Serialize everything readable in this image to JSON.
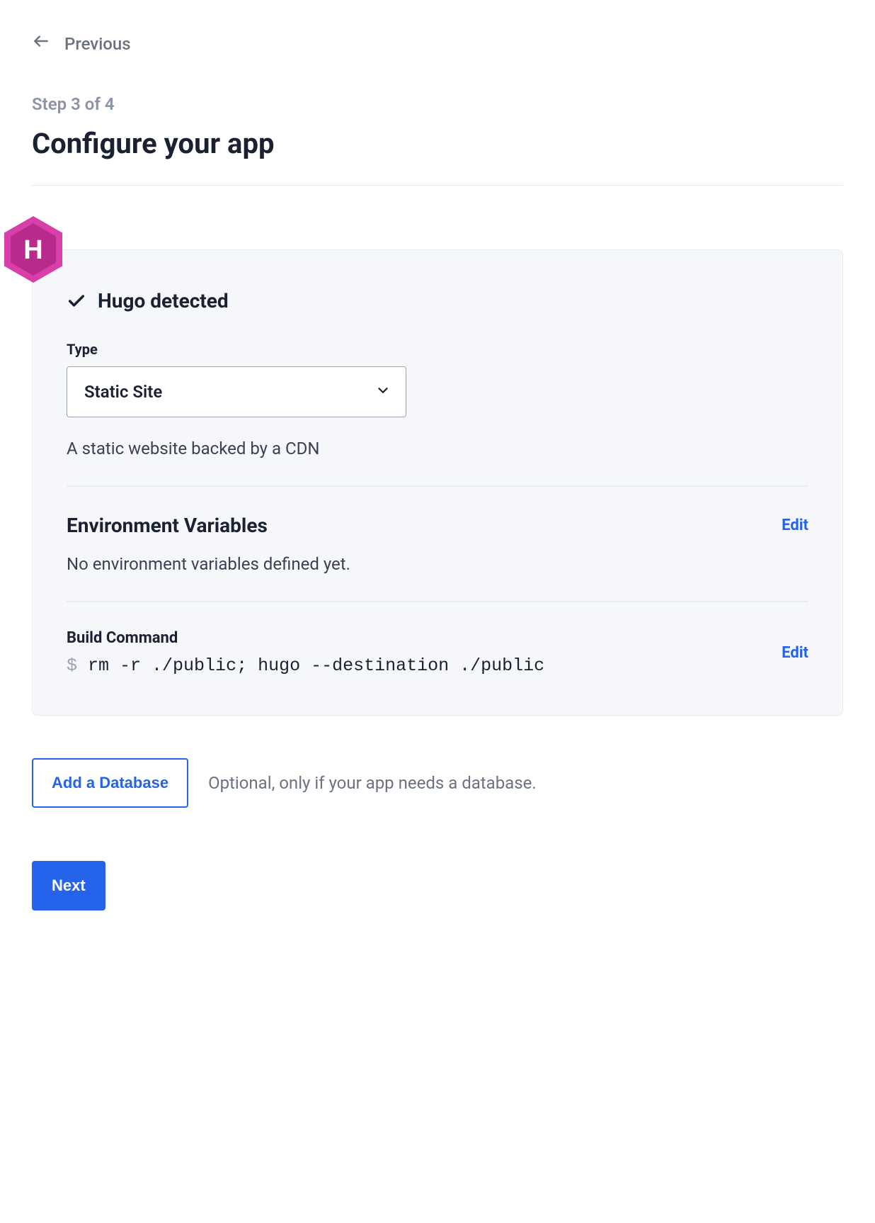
{
  "nav": {
    "previous_label": "Previous"
  },
  "header": {
    "step_label": "Step 3 of 4",
    "title": "Configure your app"
  },
  "card": {
    "badge_letter": "H",
    "detected_label": "Hugo detected",
    "type_label": "Type",
    "type_value": "Static Site",
    "type_description": "A static website backed by a CDN",
    "env_section_title": "Environment Variables",
    "env_edit_label": "Edit",
    "env_empty_text": "No environment variables defined yet.",
    "build_section_label": "Build Command",
    "build_edit_label": "Edit",
    "build_prompt": "$",
    "build_command": "rm -r ./public; hugo --destination ./public"
  },
  "database": {
    "button_label": "Add a Database",
    "hint": "Optional, only if your app needs a database."
  },
  "footer": {
    "next_label": "Next"
  },
  "colors": {
    "accent": "#2563eb",
    "badge_outer": "#d83fa9",
    "badge_inner": "#b82a8c"
  }
}
